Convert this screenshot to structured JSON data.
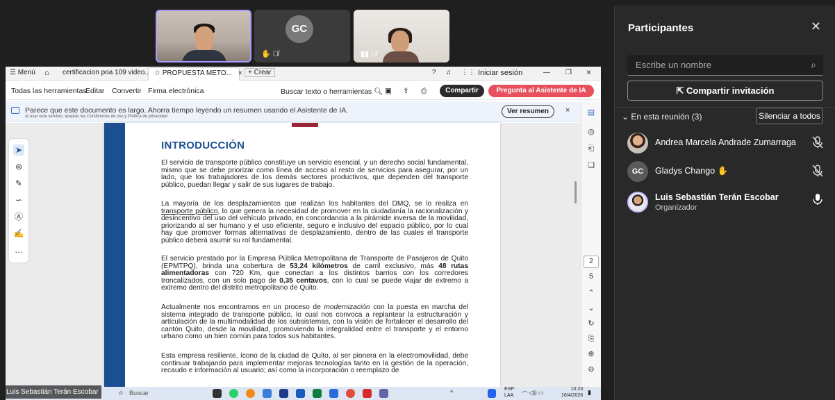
{
  "participants_panel": {
    "title": "Participantes",
    "search_placeholder": "Escribe un nombre",
    "invite_label": "Compartir invitación",
    "in_meeting_label": "En esta reunión (3)",
    "mute_all_label": "Silenciar a todos",
    "people": [
      {
        "name": "Andrea Marcela Andrade Zumarraga",
        "role": "",
        "mic": "muted"
      },
      {
        "name": "Gladys Chango",
        "initials": "GC",
        "role": "",
        "mic": "muted"
      },
      {
        "name": "Luis Sebastián Terán Escobar",
        "role": "Organizador",
        "mic": "on"
      }
    ]
  },
  "video_tiles": [
    {
      "label": ""
    },
    {
      "initials": "GC"
    },
    {
      "label": ""
    }
  ],
  "acrobat": {
    "menu_label": "Menú",
    "tabs": [
      {
        "label": "certificacion poa 109 video..."
      },
      {
        "label": "PROPUESTA METO..."
      },
      {
        "label": "Crear"
      }
    ],
    "login_label": "Iniciar sesión",
    "toolbar": {
      "all_tools": "Todas las herramientas",
      "edit": "Editar",
      "convert": "Convertir",
      "esign": "Firma electrónica",
      "search": "Buscar texto o herramientas",
      "share": "Compartir",
      "ai": "Pregunta al Asistente de IA"
    },
    "banner": {
      "text": "Parece que este documento es largo. Ahorra tiempo leyendo un resumen usando el Asistente de IA.",
      "subtext": "Al usar este servicio, aceptas las Condiciones de uso y Política de privacidad",
      "button": "Ver resumen",
      "close": "×"
    },
    "page_numbers": {
      "current": "2",
      "total": "5"
    }
  },
  "document": {
    "heading": "INTRODUCCIÓN",
    "p1": "El servicio de transporte público constituye un servicio esencial, y un derecho social fundamental, mismo que se debe priorizar como línea de acceso al resto de servicios para asegurar, por un lado, que los trabajadores de los demás sectores productivos, que dependen del transporte público, puedan llegar y salir de sus lugares de trabajo.",
    "p2_a": "La mayoría de los desplazamientos que realizan los habitantes del DMQ, se lo realiza en ",
    "p2_link": "transporte público",
    "p2_b": ", lo que genera la necesidad de promover en la ciudadanía la racionalización y desincentivo del uso del vehículo privado, en concordancia a la pirámide inversa de la movilidad, priorizando al ser humano y el uso eficiente, seguro e inclusivo del espacio público, por lo cual hay que promover formas alternativas de desplazamiento, dentro de las cuales el transporte público deberá asumir su rol fundamental.",
    "p3_a": "El servicio prestado por la Empresa Pública Metropolitana de Transporte de Pasajeros de Quito (EPMTPQ), brinda una cobertura de ",
    "p3_b1": "53,24 kilómetros",
    "p3_c": " de carril exclusivo, más ",
    "p3_b2": "48 rutas alimentadoras",
    "p3_d": " con 720 Km, que conectan a los distintos barrios con los corredores troncalizados, con un solo pago de ",
    "p3_b3": "0,35 centavos",
    "p3_e": ", con lo cual se puede viajar de extremo a extremo dentro del distrito metropolitano de Quito.",
    "p4_a": "Actualmente nos encontramos en un proceso de ",
    "p4_i": "modernización",
    "p4_b": " con la puesta en marcha del sistema integrado de transporte público, lo cual nos convoca a replantear la estructuración y articulación de la multimodalidad de los subsistemas, con la visión de fortalecer el desarrollo del cantón Quito, desde la movilidad, promoviendo la integralidad entre el transporte y el entorno urbano como un bien común para todos sus habitantes.",
    "p5": "Esta empresa resiliente, ícono de la ciudad de Quito, al ser pionera en la electromovilidad, debe continuar trabajando para implementar mejoras tecnologías tanto en la gestión de la operación, recaudo e información al usuario; así como la incorporación o reemplazo de"
  },
  "taskbar": {
    "speaker_name": "Luis Sebastián Terán Escobar",
    "search": "Buscar",
    "lang": "ESP",
    "lang2": "LAA",
    "time": "10:23",
    "date": "16/4/2026"
  },
  "colors": {
    "panel_bg": "#292929",
    "accent_purple": "#a99bff",
    "doc_blue": "#1b4f91",
    "ai_button": "#e7505c"
  }
}
